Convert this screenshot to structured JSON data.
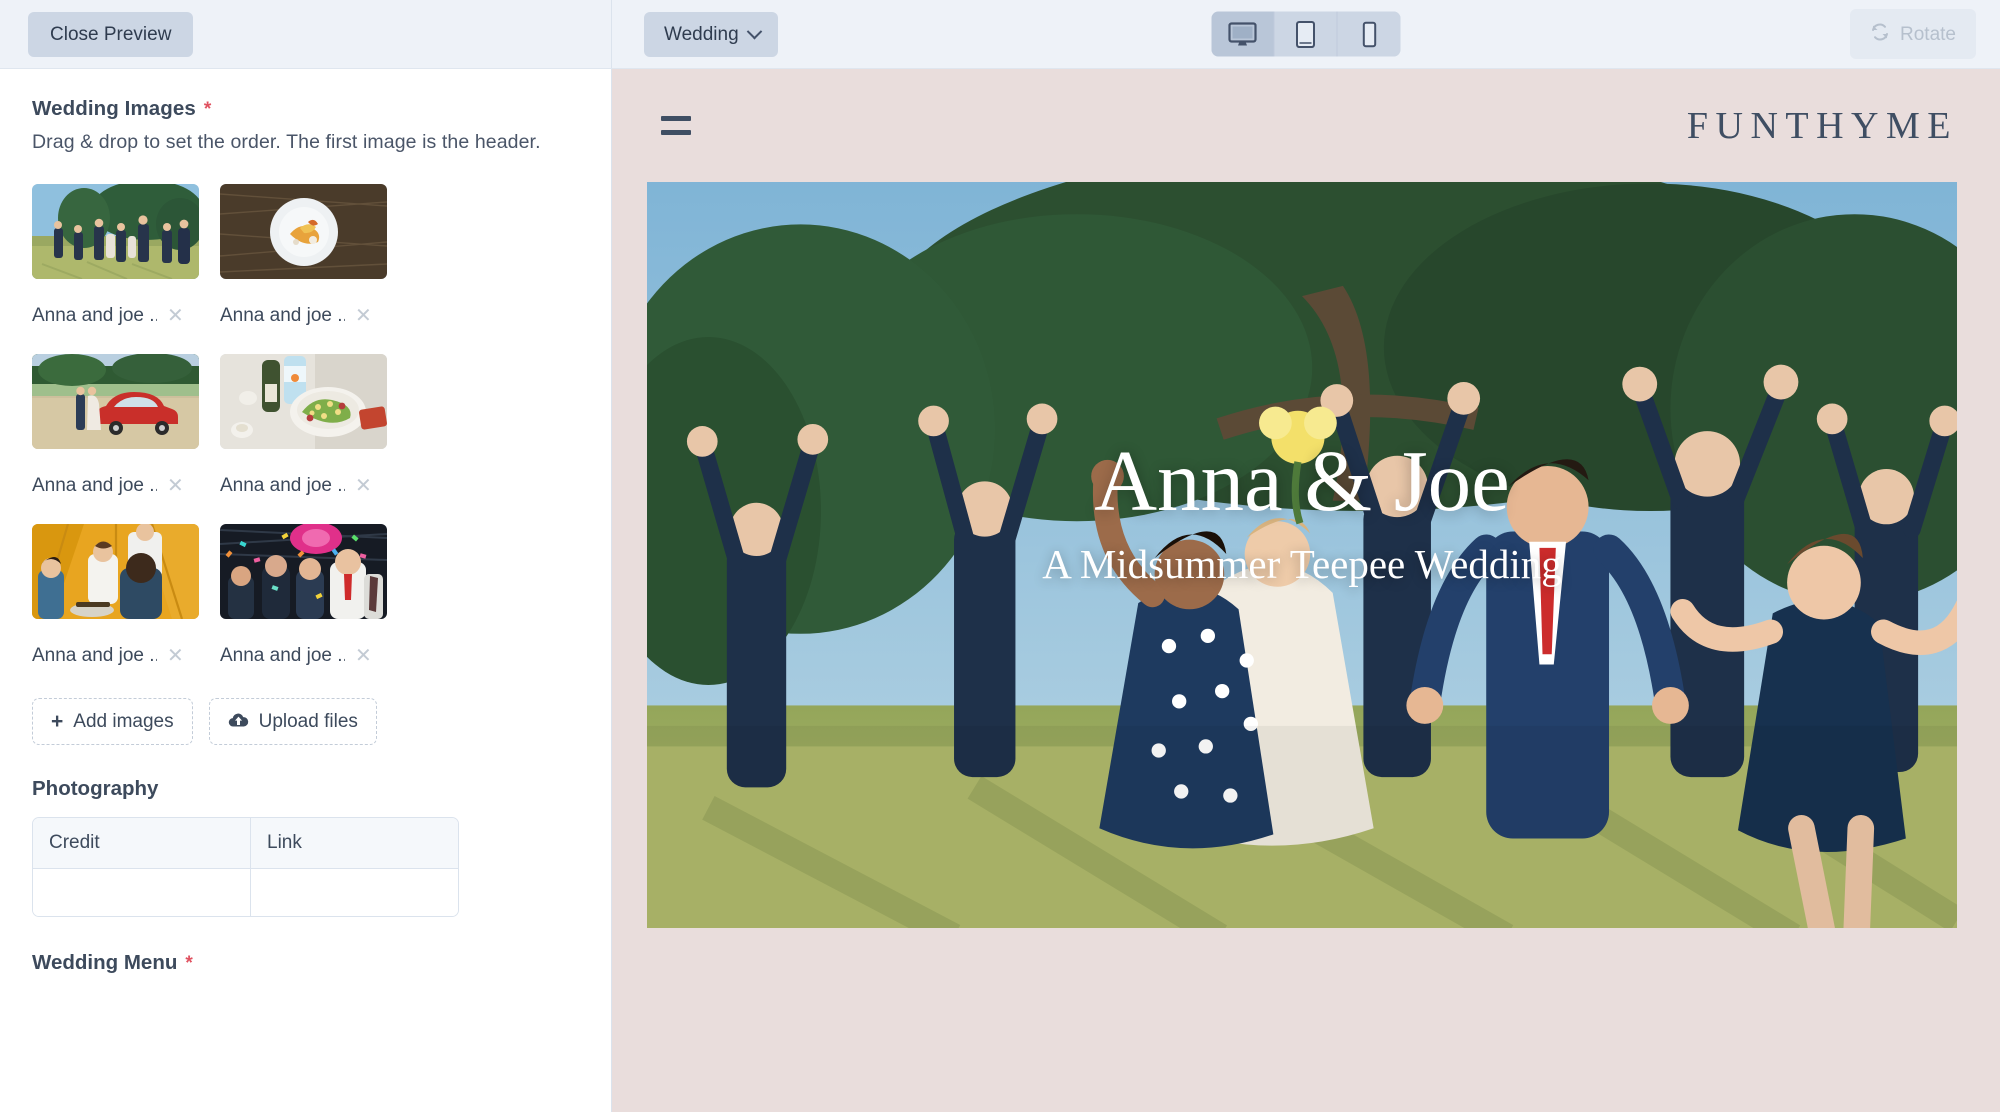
{
  "topbar": {
    "close_preview_label": "Close Preview",
    "page_selector_label": "Wedding",
    "page_selector_icon": "chevron-down-icon",
    "devices": [
      {
        "name": "desktop",
        "icon": "desktop-icon",
        "active": true
      },
      {
        "name": "tablet",
        "icon": "tablet-icon",
        "active": false
      },
      {
        "name": "mobile",
        "icon": "mobile-icon",
        "active": false
      }
    ],
    "rotate_label": "Rotate",
    "rotate_icon": "rotate-icon",
    "rotate_disabled": true
  },
  "editor": {
    "images_field": {
      "label": "Wedding Images",
      "required_marker": "*",
      "help": "Drag & drop to set the order. The first image is the header.",
      "items": [
        {
          "name": "Anna and joe ...",
          "remove_icon": "close-icon",
          "alt": "wedding party running in field"
        },
        {
          "name": "Anna and joe ...",
          "remove_icon": "close-icon",
          "alt": "plated food on white dish"
        },
        {
          "name": "Anna and joe ...",
          "remove_icon": "close-icon",
          "alt": "couple beside red vintage car"
        },
        {
          "name": "Anna and joe ...",
          "remove_icon": "close-icon",
          "alt": "salad bowl and wine on table"
        },
        {
          "name": "Anna and joe ...",
          "remove_icon": "close-icon",
          "alt": "guests dining inside teepee"
        },
        {
          "name": "Anna and joe ...",
          "remove_icon": "close-icon",
          "alt": "guests celebrating with confetti"
        }
      ],
      "add_images_label": "Add images",
      "add_images_icon": "plus-icon",
      "upload_files_label": "Upload files",
      "upload_files_icon": "cloud-upload-icon"
    },
    "photography": {
      "label": "Photography",
      "columns": [
        "Credit",
        "Link"
      ],
      "rows": [
        {
          "credit": "",
          "link": ""
        }
      ],
      "credit_placeholder": "",
      "link_placeholder": ""
    },
    "menu_field": {
      "label": "Wedding Menu",
      "required_marker": "*"
    }
  },
  "preview": {
    "menu_icon": "hamburger-menu-icon",
    "brand": "FUNTHYME",
    "hero": {
      "title": "Anna & Joe",
      "subtitle": "A Midsummer Teepee Wedding",
      "alt": "wedding party jumping and cheering under a large tree"
    }
  },
  "colors": {
    "topbar_bg": "#eef2f8",
    "button_bg": "#ccd6e4",
    "accent_required": "#e05260",
    "preview_bg": "#e9dddc",
    "brand_text": "#3f4e63",
    "text_primary": "#3d4a5c"
  }
}
